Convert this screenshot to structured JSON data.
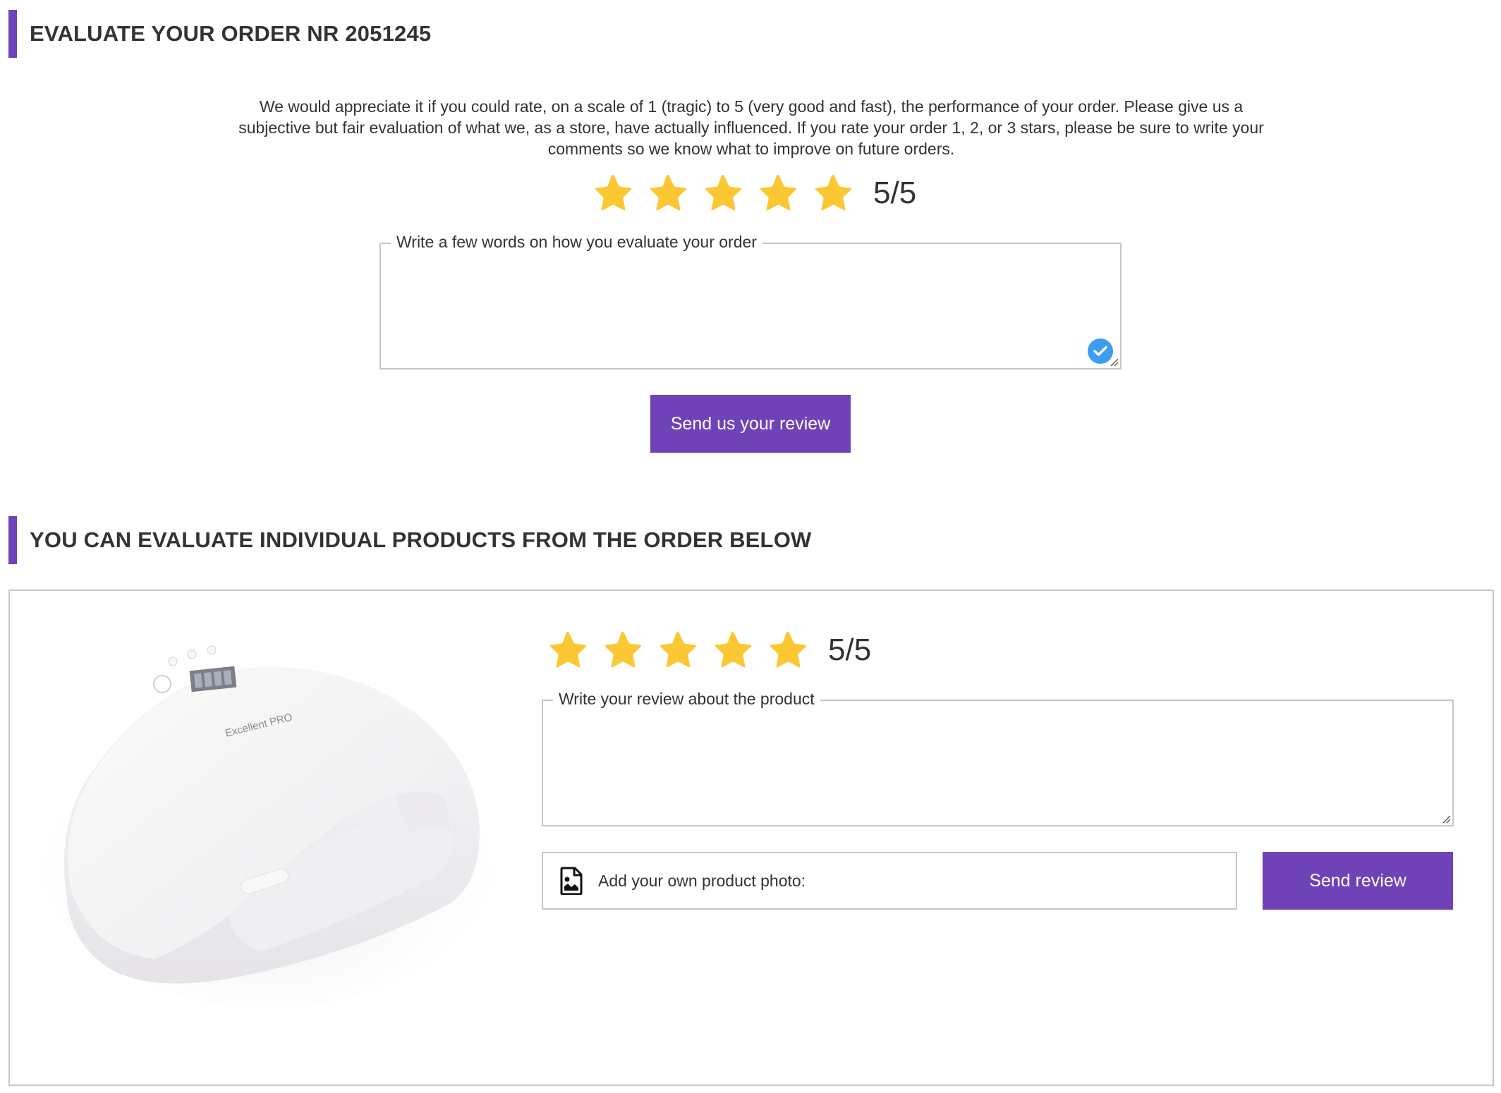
{
  "order_section": {
    "heading": "EVALUATE YOUR ORDER NR 2051245",
    "intro_text": "We would appreciate it if you could rate, on a scale of 1 (tragic) to 5 (very good and fast), the performance of your order. Please give us a subjective but fair evaluation of what we, as a store, have actually influenced. If you rate your order 1, 2, or 3 stars, please be sure to write your comments so we know what to improve on future orders.",
    "rating": {
      "value": 5,
      "max": 5,
      "label": "5/5"
    },
    "comment": {
      "legend": "Write a few words on how you evaluate your order",
      "value": "",
      "validated": true
    },
    "submit_label": "Send us your review"
  },
  "products_section": {
    "heading": "YOU CAN EVALUATE INDIVIDUAL PRODUCTS FROM THE ORDER BELOW",
    "products": [
      {
        "image_alt": "Excellent PRO UV/LED nail lamp",
        "brand_text": "Excellent PRO",
        "rating": {
          "value": 5,
          "max": 5,
          "label": "5/5"
        },
        "review": {
          "legend": "Write your review about the product",
          "value": ""
        },
        "photo_label": "Add your own product photo:",
        "submit_label": "Send review"
      }
    ]
  },
  "colors": {
    "accent": "#6f42b8",
    "star": "#fbc833",
    "border": "#c4c8c7",
    "check_badge": "#3d9df2",
    "text": "#333333"
  },
  "icons": {
    "star": "star-icon",
    "check": "check-circle-icon",
    "photo": "image-file-icon"
  }
}
